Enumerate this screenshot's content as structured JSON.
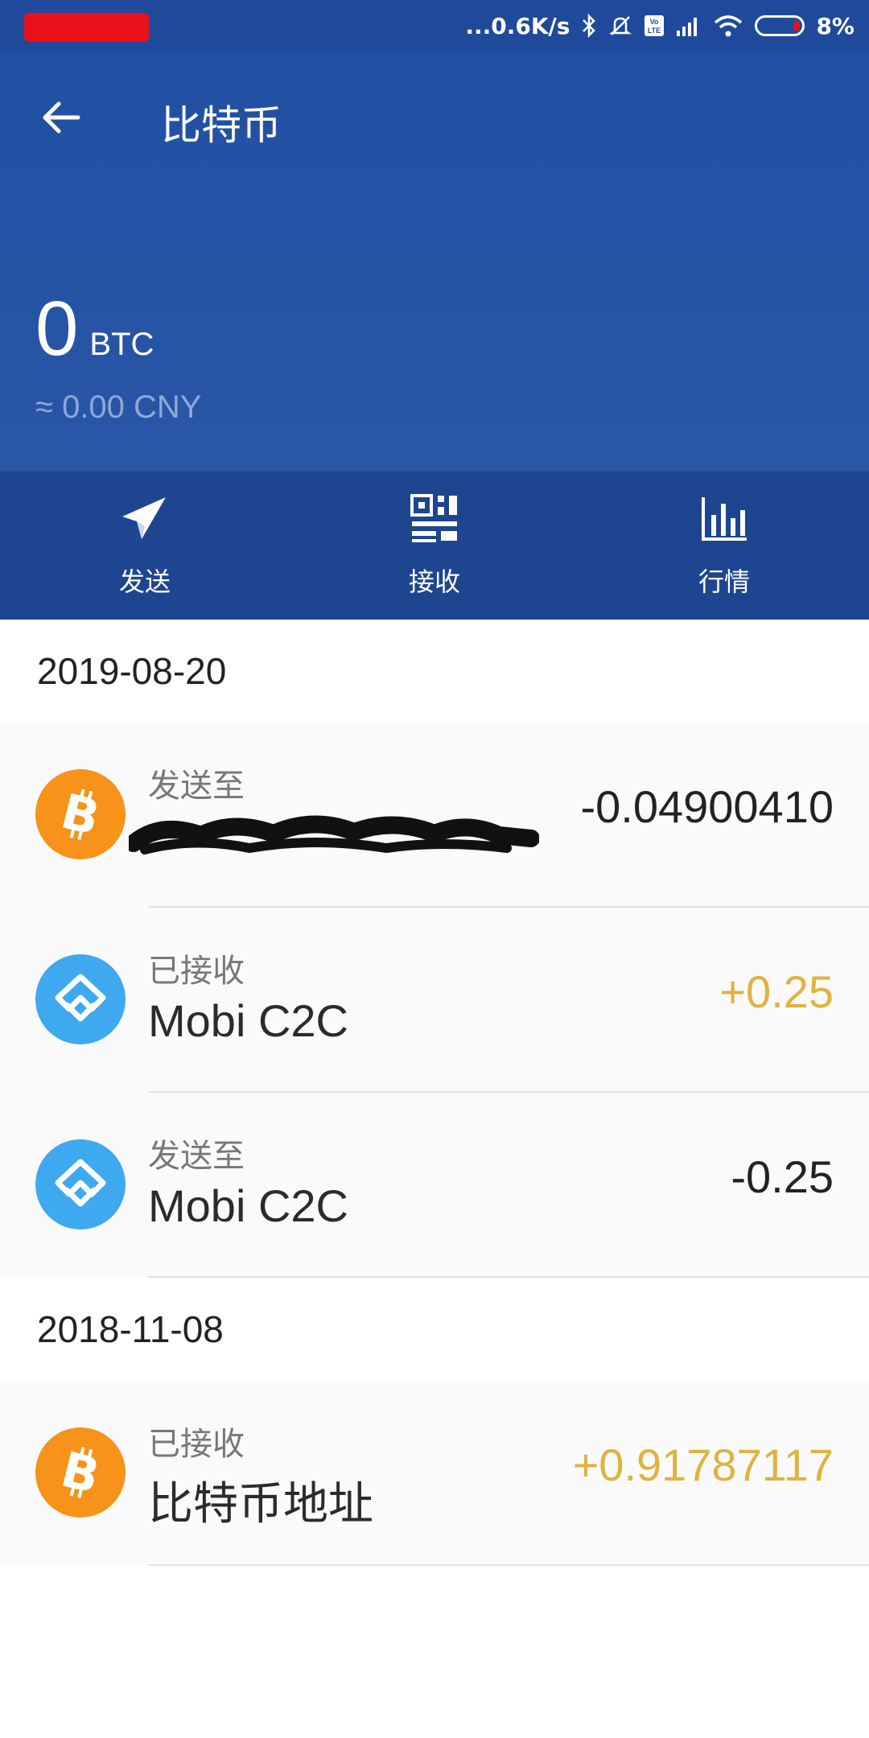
{
  "status_bar": {
    "net_speed": "...0.6K/s",
    "battery": "8%",
    "icons": [
      "bluetooth-icon",
      "silent-icon",
      "volte-icon",
      "signal-icon",
      "wifi-icon",
      "battery-icon"
    ]
  },
  "header": {
    "title": "比特币",
    "balance": "0",
    "unit": "BTC",
    "fiat": "≈ 0.00 CNY",
    "colors": {
      "primary": "#2150a3",
      "action_bar": "#1e4590"
    }
  },
  "actions": [
    {
      "label": "发送",
      "icon": "send-icon"
    },
    {
      "label": "接收",
      "icon": "qr-code-icon"
    },
    {
      "label": "行情",
      "icon": "chart-icon"
    }
  ],
  "groups": [
    {
      "date": "2019-08-20",
      "transactions": [
        {
          "type": "发送至",
          "party": "",
          "amount": "-0.04900410",
          "avatar": "bitcoin-icon",
          "direction": "out"
        },
        {
          "type": "已接收",
          "party": "Mobi C2C",
          "amount": "+0.25",
          "avatar": "mobi-icon",
          "direction": "in"
        },
        {
          "type": "发送至",
          "party": "Mobi C2C",
          "amount": "-0.25",
          "avatar": "mobi-icon",
          "direction": "out"
        }
      ]
    },
    {
      "date": "2018-11-08",
      "transactions": [
        {
          "type": "已接收",
          "party": "比特币地址",
          "amount": "+0.91787117",
          "avatar": "bitcoin-icon",
          "direction": "in"
        }
      ]
    }
  ],
  "colors": {
    "positive": "#e0b23f",
    "negative": "#222222",
    "bitcoin": "#f7931a",
    "mobi": "#3ea9ef"
  }
}
